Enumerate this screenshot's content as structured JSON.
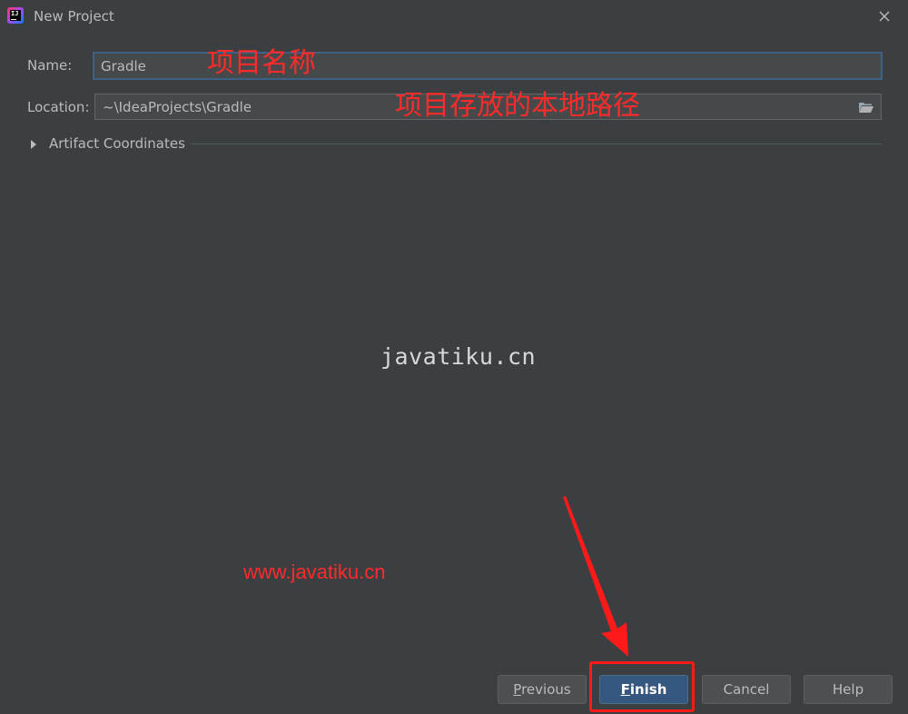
{
  "window": {
    "title": "New Project",
    "icon": "intellij-idea-icon"
  },
  "form": {
    "name_label": "Name:",
    "name_value": "Gradle",
    "location_label": "Location:",
    "location_value": "~\\IdeaProjects\\Gradle",
    "artifact_label": "Artifact Coordinates"
  },
  "annotations": {
    "name_note": "项目名称",
    "location_note": "项目存放的本地路径",
    "url": "www.javatiku.cn",
    "watermark": "javatiku.cn",
    "color": "#ff2a2a"
  },
  "buttons": {
    "previous_mnemonic": "P",
    "previous_rest": "revious",
    "finish_mnemonic": "F",
    "finish_rest": "inish",
    "cancel": "Cancel",
    "help": "Help"
  },
  "theme": {
    "background": "#3c3f41",
    "field": "#45494a",
    "focus": "#3d6185",
    "primary_button": "#365880"
  }
}
